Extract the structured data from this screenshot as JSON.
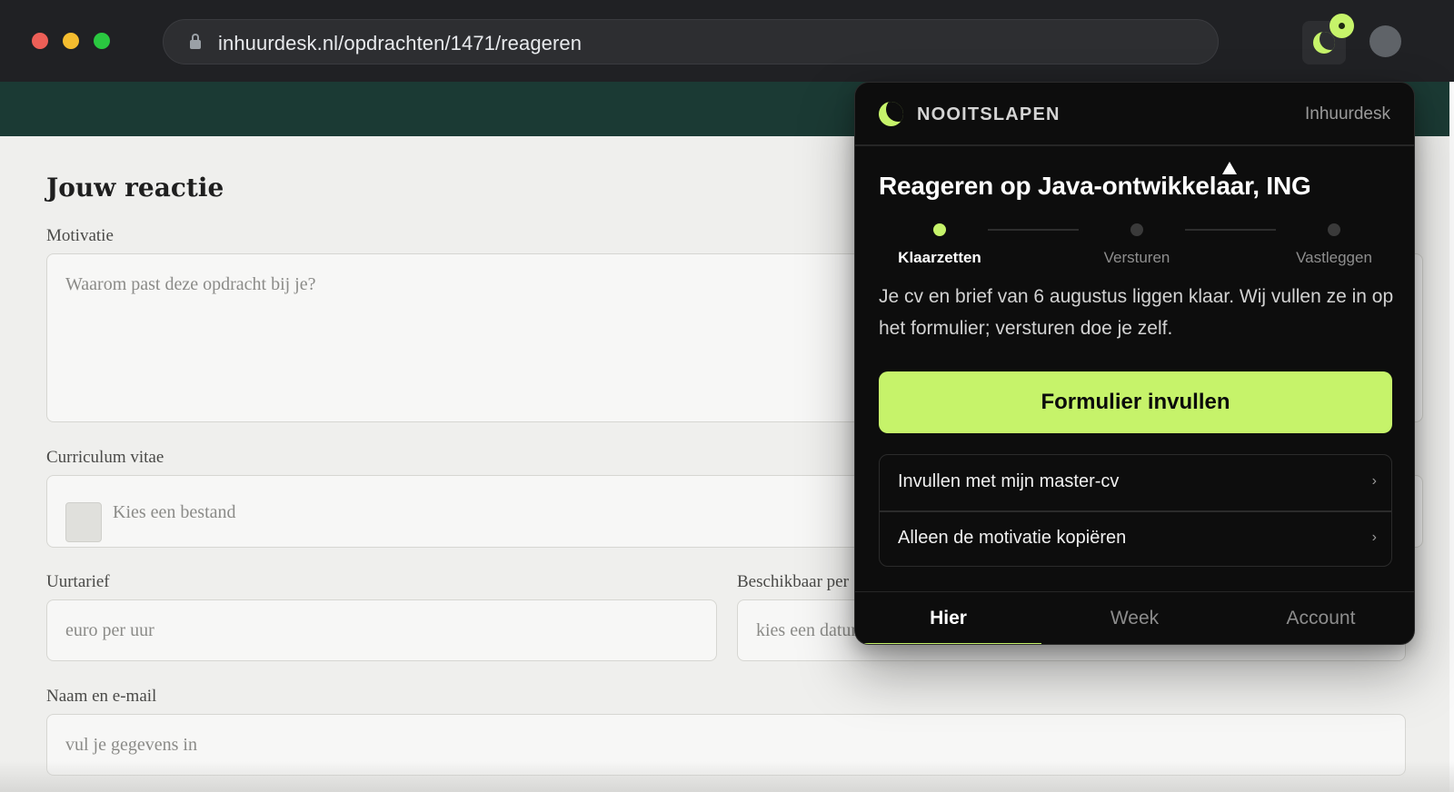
{
  "browser": {
    "url": "inhuurdesk.nl/opdrachten/1471/reageren",
    "icons": [
      "lock-icon",
      "extension-moon-icon",
      "profile-avatar"
    ]
  },
  "page": {
    "title": "Jouw reactie",
    "fields": {
      "motivation": {
        "label": "Motivatie",
        "placeholder": "Waarom past deze opdracht bij je?"
      },
      "cv": {
        "label": "Curriculum vitae",
        "placeholder": "Kies een bestand"
      },
      "rate": {
        "label": "Uurtarief",
        "placeholder": "euro per uur"
      },
      "availability": {
        "label": "Beschikbaar per",
        "placeholder": "kies een datum"
      },
      "contact": {
        "label": "Naam en e-mail",
        "placeholder": "vul je gegevens in"
      }
    }
  },
  "extension": {
    "brand": "NOOITSLAPEN",
    "site": "Inhuurdesk",
    "title": "Reageren op Java-ontwikkelaar, ING",
    "steps": [
      {
        "label": "Klaarzetten",
        "active": true
      },
      {
        "label": "Versturen",
        "active": false
      },
      {
        "label": "Vastleggen",
        "active": false
      }
    ],
    "description": "Je cv en brief van 6 augustus liggen klaar. Wij vullen ze in op het formulier; versturen doe je zelf.",
    "primary_action": "Formulier invullen",
    "options": [
      {
        "label": "Invullen met mijn master-cv",
        "chevron": "›"
      },
      {
        "label": "Alleen de motivatie kopiëren",
        "chevron": "›"
      }
    ],
    "tabs": [
      {
        "label": "Hier",
        "active": true
      },
      {
        "label": "Week",
        "active": false
      },
      {
        "label": "Account",
        "active": false
      }
    ],
    "accent_color": "#c6f36a"
  }
}
